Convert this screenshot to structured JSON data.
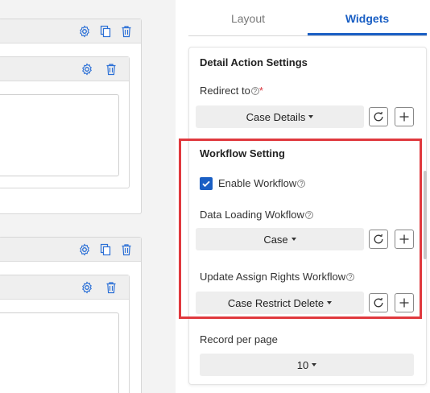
{
  "tabs": [
    {
      "label": "Layout",
      "active": false
    },
    {
      "label": "Widgets",
      "active": true
    }
  ],
  "detail_action": {
    "title": "Detail Action Settings",
    "redirect_label": "Redirect to",
    "required_mark": "*",
    "redirect_value": "Case Details"
  },
  "workflow": {
    "title": "Workflow Setting",
    "enable_label": "Enable Workflow",
    "enable_checked": true,
    "data_loading_label": "Data Loading Wokflow",
    "data_loading_value": "Case",
    "update_rights_label": "Update Assign Rights Workflow",
    "update_rights_value": "Case Restrict Delete"
  },
  "record": {
    "label": "Record per page",
    "value": "10"
  },
  "help_glyph": "?",
  "colors": {
    "accent": "#1a5fc4",
    "highlight_border": "#e0393e",
    "icon_blue": "#2a6fd6"
  }
}
